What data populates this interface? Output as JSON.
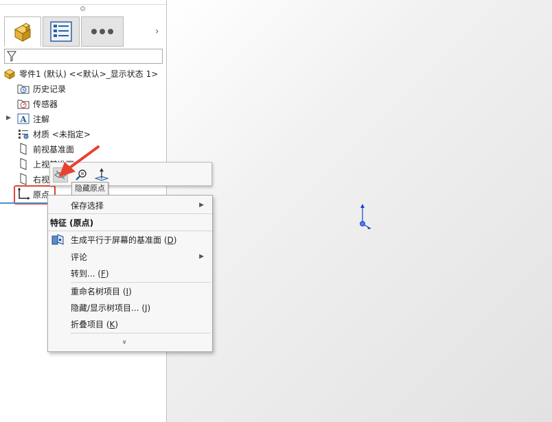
{
  "feature_manager": {
    "tabs": [
      {
        "name": "part-feature-tab",
        "icon": "part-cube-icon",
        "active": true
      },
      {
        "name": "property-manager-tab",
        "icon": "property-list-icon",
        "active": false
      },
      {
        "name": "more-tabs",
        "icon": "ellipsis-icon",
        "active": false
      }
    ],
    "expand_tabs_label": "›",
    "filter_icon": "filter-funnel-icon",
    "tree": {
      "root": "零件1 (默认) <<默认>_显示状态 1>",
      "items": [
        {
          "label": "历史记录",
          "icon": "history-folder-icon"
        },
        {
          "label": "传感器",
          "icon": "sensor-folder-icon"
        },
        {
          "label": "注解",
          "icon": "annotation-icon",
          "expandable": true
        },
        {
          "label": "材质 <未指定>",
          "icon": "material-icon"
        },
        {
          "label": "前视基准面",
          "icon": "plane-icon"
        },
        {
          "label": "上视基准面",
          "icon": "plane-icon"
        },
        {
          "label": "右视基准面",
          "icon": "plane-icon"
        },
        {
          "label": "原点",
          "icon": "origin-icon",
          "selected": true
        }
      ]
    }
  },
  "context_toolbar": {
    "buttons": [
      {
        "name": "hide-origin-button",
        "icon": "eye-hide-icon",
        "active": true
      },
      {
        "name": "zoom-to-selection-button",
        "icon": "zoom-icon"
      },
      {
        "name": "normal-to-button",
        "icon": "normal-to-icon"
      }
    ],
    "tooltip": "隐藏原点"
  },
  "context_menu": {
    "save_selection": "保存选择",
    "section_header": "特征 (原点)",
    "items": [
      {
        "text": "生成平行于屏幕的基准面",
        "key": "D",
        "icon": "plane-screen-icon"
      },
      {
        "text": "评论",
        "submenu": true
      },
      {
        "text": "转到...",
        "key": "F"
      },
      {
        "text": "重命名树项目",
        "key": "I"
      },
      {
        "text": "隐藏/显示树项目...",
        "key": "J"
      },
      {
        "text": "折叠项目",
        "key": "K"
      }
    ],
    "more_glyph": "»"
  },
  "colors": {
    "highlight_box": "#e0443a",
    "annotation_arrow": "#e8412f",
    "origin_axis": "#1a3fd6",
    "selection_line": "#4a90c8"
  }
}
